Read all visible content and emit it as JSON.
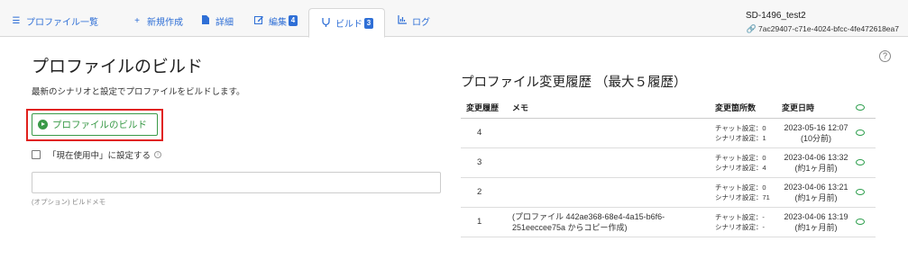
{
  "tabs": [
    {
      "label": "プロファイル一覧",
      "icon": "list-icon"
    },
    {
      "label": "新規作成",
      "icon": "plus-icon"
    },
    {
      "label": "詳細",
      "icon": "document-icon"
    },
    {
      "label": "編集",
      "icon": "edit-icon",
      "badge": "4"
    },
    {
      "label": "ビルド",
      "icon": "build-icon",
      "badge": "3",
      "active": true
    },
    {
      "label": "ログ",
      "icon": "chart-icon"
    }
  ],
  "profile": {
    "name": "SD-1496_test2",
    "id": "7ac29407-c71e-4024-bfcc-4fe472618ea7"
  },
  "build": {
    "title": "プロファイルのビルド",
    "description": "最新のシナリオと設定でプロファイルをビルドします。",
    "button_label": "プロファイルのビルド",
    "checkbox_label": "「現在使用中」に設定する",
    "memo_value": "",
    "memo_hint": "(オプション) ビルドメモ"
  },
  "history": {
    "title": "プロファイル変更履歴 （最大５履歴）",
    "columns": [
      "変更履歴",
      "メモ",
      "変更箇所数",
      "変更日時"
    ],
    "rows": [
      {
        "version": "4",
        "memo": "",
        "chat": "チャット設定：0",
        "scenario": "シナリオ設定：1",
        "date": "2023-05-16 12:07",
        "rel": "(10分前)"
      },
      {
        "version": "3",
        "memo": "",
        "chat": "チャット設定：0",
        "scenario": "シナリオ設定：4",
        "date": "2023-04-06 13:32",
        "rel": "(約1ヶ月前)"
      },
      {
        "version": "2",
        "memo": "",
        "chat": "チャット設定：0",
        "scenario": "シナリオ設定：71",
        "date": "2023-04-06 13:21",
        "rel": "(約1ヶ月前)"
      },
      {
        "version": "1",
        "memo": "(プロファイル 442ae368-68e4-4a15-b6f6-251eeccee75a からコピー作成)",
        "chat": "チャット設定：-",
        "scenario": "シナリオ設定：-",
        "date": "2023-04-06 13:19",
        "rel": "(約1ヶ月前)"
      }
    ]
  },
  "colors": {
    "link": "#2f6fd6",
    "build_green": "#3a9a48",
    "highlight_red": "#e0201c"
  }
}
